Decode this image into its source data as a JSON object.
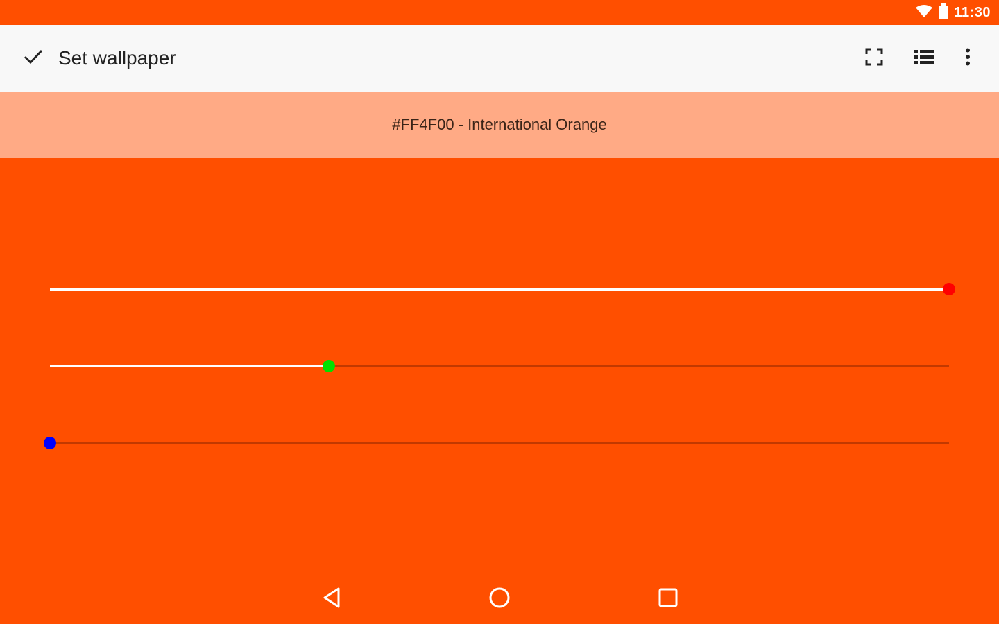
{
  "status_bar": {
    "time": "11:30",
    "icons": [
      "wifi-icon",
      "battery-icon"
    ]
  },
  "toolbar": {
    "check_icon": "check-icon",
    "title": "Set wallpaper",
    "actions": [
      "fullscreen-icon",
      "list-icon",
      "more-vert-icon"
    ]
  },
  "color": {
    "hex": "#FF4F00",
    "label": "#FF4F00 - International Orange",
    "banner_color": "#FFAA85"
  },
  "sliders": [
    {
      "channel": "red",
      "value": 255,
      "max": 255,
      "thumb_color": "#FF0000"
    },
    {
      "channel": "green",
      "value": 79,
      "max": 255,
      "thumb_color": "#00E000"
    },
    {
      "channel": "blue",
      "value": 0,
      "max": 255,
      "thumb_color": "#0000FF"
    }
  ],
  "nav_bar": {
    "buttons": [
      "back-icon",
      "home-icon",
      "recents-icon"
    ]
  }
}
